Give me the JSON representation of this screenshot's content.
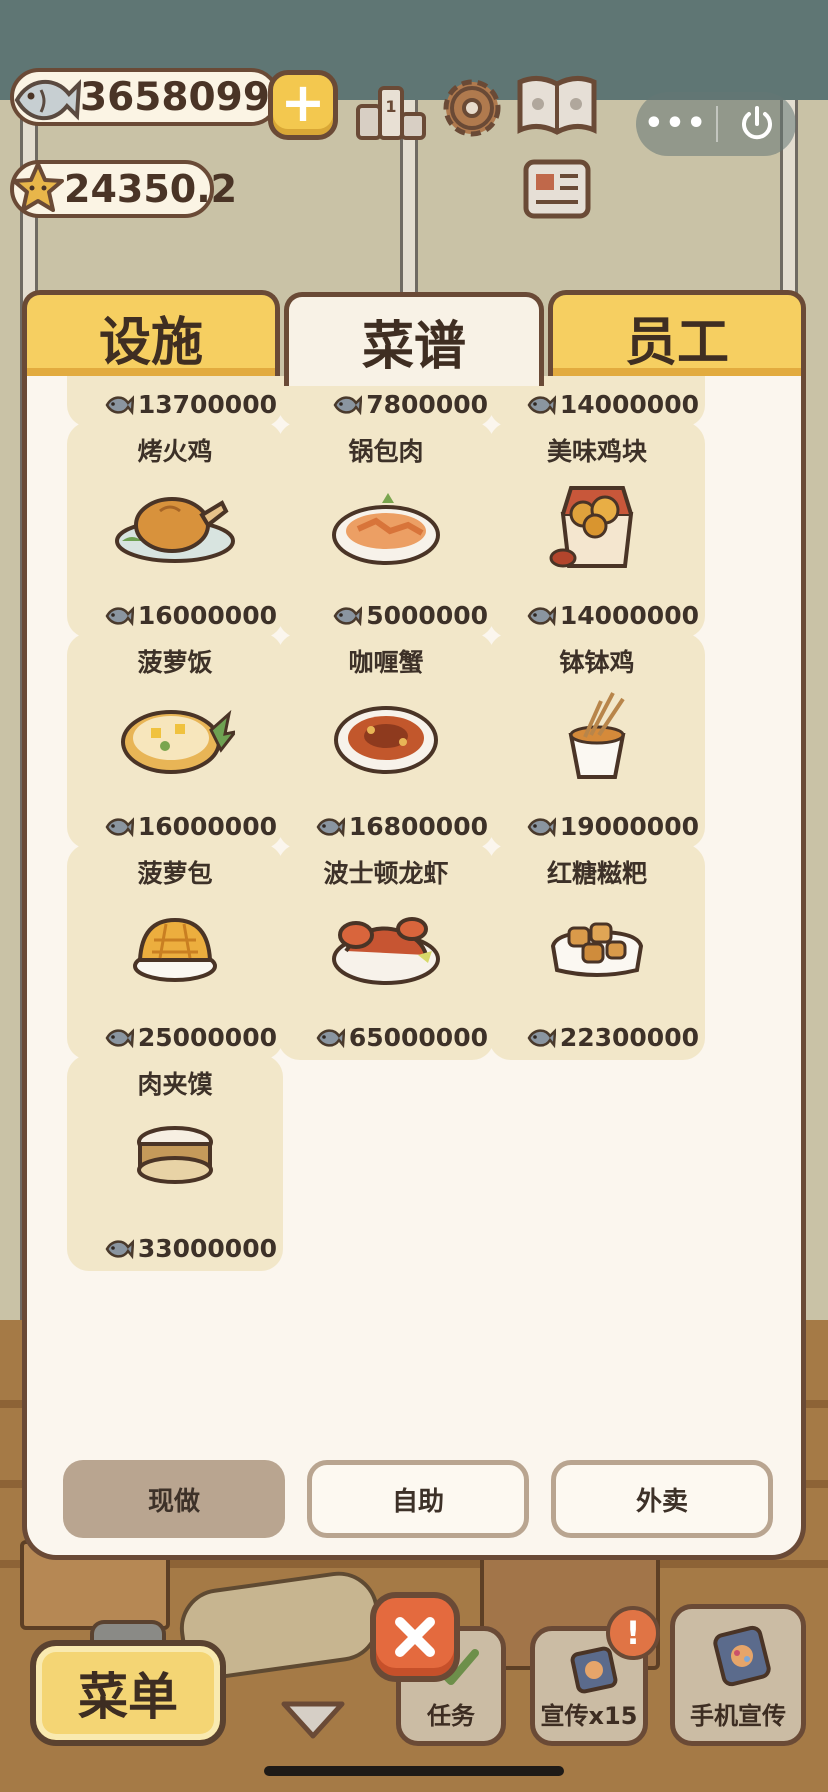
{
  "hud": {
    "fish_currency": "3658099",
    "star_currency": "24350.2",
    "add_currency_label": "+",
    "capsule_more_label": "•••"
  },
  "tabs": [
    {
      "label": "设施",
      "active": false
    },
    {
      "label": "菜谱",
      "active": true
    },
    {
      "label": "员工",
      "active": false
    }
  ],
  "recipes": [
    {
      "name": "",
      "price": "13700000",
      "icon": "partial-dish"
    },
    {
      "name": "",
      "price": "7800000",
      "icon": "partial-dish"
    },
    {
      "name": "",
      "price": "14000000",
      "icon": "partial-dish"
    },
    {
      "name": "烤火鸡",
      "price": "16000000",
      "icon": "roast-turkey"
    },
    {
      "name": "锅包肉",
      "price": "5000000",
      "icon": "fried-pork"
    },
    {
      "name": "美味鸡块",
      "price": "14000000",
      "icon": "chicken-nuggets"
    },
    {
      "name": "菠萝饭",
      "price": "16000000",
      "icon": "pineapple-rice"
    },
    {
      "name": "咖喱蟹",
      "price": "16800000",
      "icon": "curry-crab"
    },
    {
      "name": "钵钵鸡",
      "price": "19000000",
      "icon": "skewer-cup"
    },
    {
      "name": "菠萝包",
      "price": "25000000",
      "icon": "pineapple-bun"
    },
    {
      "name": "波士顿龙虾",
      "price": "65000000",
      "icon": "lobster"
    },
    {
      "name": "红糖糍粑",
      "price": "22300000",
      "icon": "rice-cake"
    },
    {
      "name": "肉夹馍",
      "price": "33000000",
      "icon": "meat-bun"
    }
  ],
  "mode_buttons": [
    {
      "label": "现做",
      "selected": true
    },
    {
      "label": "自助",
      "selected": false
    },
    {
      "label": "外卖",
      "selected": false
    }
  ],
  "bottom_bar": {
    "menu_label": "菜单",
    "task_label": "任务",
    "promo_label": "宣传x15",
    "phone_promo_label": "手机宣传",
    "alert_mark": "!"
  },
  "colors": {
    "tab_inactive": "#f6cf61",
    "panel_bg": "#fbf6ee",
    "card_bg": "#f2e7c9",
    "outline": "#6a4a36",
    "close_button": "#e46a3e"
  }
}
